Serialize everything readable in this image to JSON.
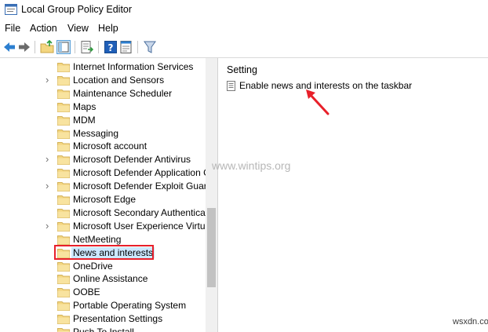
{
  "window": {
    "title": "Local Group Policy Editor",
    "icon": "gpedit-icon"
  },
  "menu": [
    "File",
    "Action",
    "View",
    "Help"
  ],
  "toolbar": {
    "buttons": [
      "back-arrow-icon",
      "forward-arrow-icon",
      "up-folder-icon",
      "show-hide-tree-icon",
      "export-list-icon",
      "help-icon",
      "properties-icon",
      "filter-icon"
    ]
  },
  "tree": {
    "items": [
      {
        "label": "Internet Information Services",
        "expandable": false
      },
      {
        "label": "Location and Sensors",
        "expandable": true
      },
      {
        "label": "Maintenance Scheduler",
        "expandable": false
      },
      {
        "label": "Maps",
        "expandable": false
      },
      {
        "label": "MDM",
        "expandable": false
      },
      {
        "label": "Messaging",
        "expandable": false
      },
      {
        "label": "Microsoft account",
        "expandable": false
      },
      {
        "label": "Microsoft Defender Antivirus",
        "expandable": true
      },
      {
        "label": "Microsoft Defender Application Gu",
        "expandable": false
      },
      {
        "label": "Microsoft Defender Exploit Guard",
        "expandable": true
      },
      {
        "label": "Microsoft Edge",
        "expandable": false
      },
      {
        "label": "Microsoft Secondary Authenticatio",
        "expandable": false
      },
      {
        "label": "Microsoft User Experience Virtualiz",
        "expandable": true
      },
      {
        "label": "NetMeeting",
        "expandable": false
      },
      {
        "label": "News and interests",
        "expandable": false,
        "selected": true
      },
      {
        "label": "OneDrive",
        "expandable": false
      },
      {
        "label": "Online Assistance",
        "expandable": false
      },
      {
        "label": "OOBE",
        "expandable": false
      },
      {
        "label": "Portable Operating System",
        "expandable": false
      },
      {
        "label": "Presentation Settings",
        "expandable": false
      },
      {
        "label": "Push To Install",
        "expandable": false
      }
    ]
  },
  "details": {
    "column_header": "Setting",
    "settings": [
      "Enable news and interests on the taskbar"
    ]
  },
  "watermark": "www.wintips.org",
  "corner_watermark": "wsxdn.com",
  "colors": {
    "highlight_border": "#e8202a",
    "selection": "#cce8ff",
    "folder": "#f3d680",
    "arrow": "#e8202a"
  }
}
